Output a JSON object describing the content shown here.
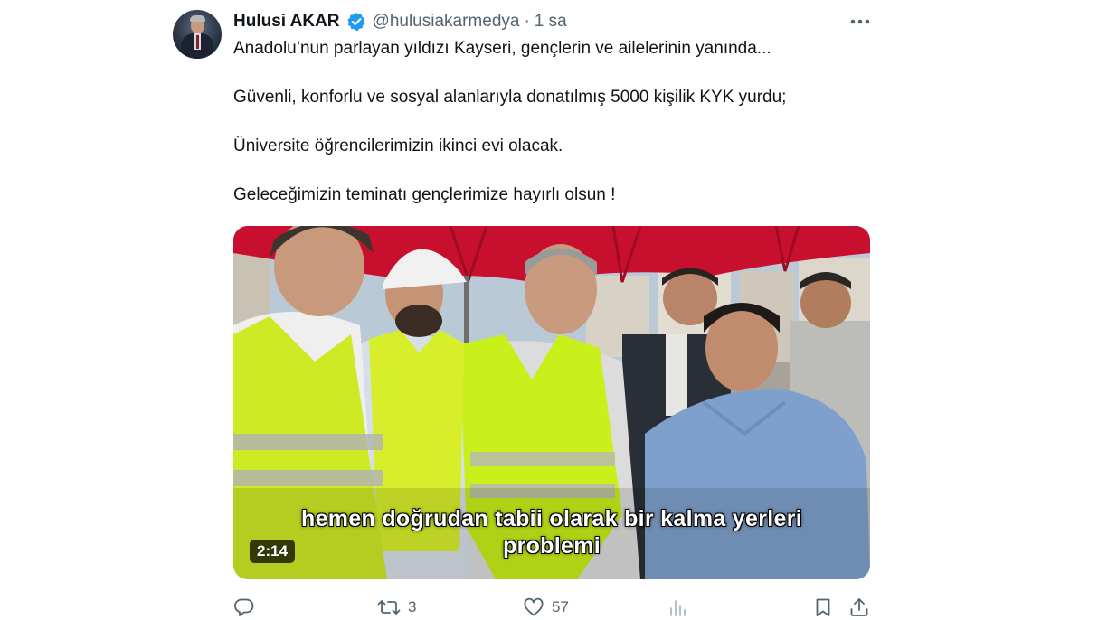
{
  "author": {
    "display_name": "Hulusi AKAR",
    "handle": "@hulusiakarmedya",
    "separator": "·",
    "timestamp": "1 sa",
    "verified_color": "#1d9bf0"
  },
  "tweet": {
    "lines": [
      "Anadolu’nun parlayan yıldızı Kayseri, gençlerin ve ailelerinin yanında...",
      "Güvenli, konforlu ve sosyal alanlarıyla donatılmış 5000 kişilik KYK yurdu;",
      "Üniversite öğrencilerimizin ikinci evi olacak.",
      "Geleceğimizin teminatı gençlerimize hayırlı olsun !"
    ]
  },
  "video": {
    "subtitle_line1": "hemen doğrudan tabii olarak bir kalma yerleri",
    "subtitle_line2": "problemi",
    "duration": "2:14"
  },
  "actions": {
    "reply_icon": "reply-icon",
    "retweet_count": "3",
    "like_count": "57",
    "views_icon": "views-icon",
    "bookmark_icon": "bookmark-icon",
    "share_icon": "share-icon"
  },
  "colors": {
    "text_primary": "#0f1419",
    "text_secondary": "#536471",
    "accent": "#1d9bf0"
  }
}
